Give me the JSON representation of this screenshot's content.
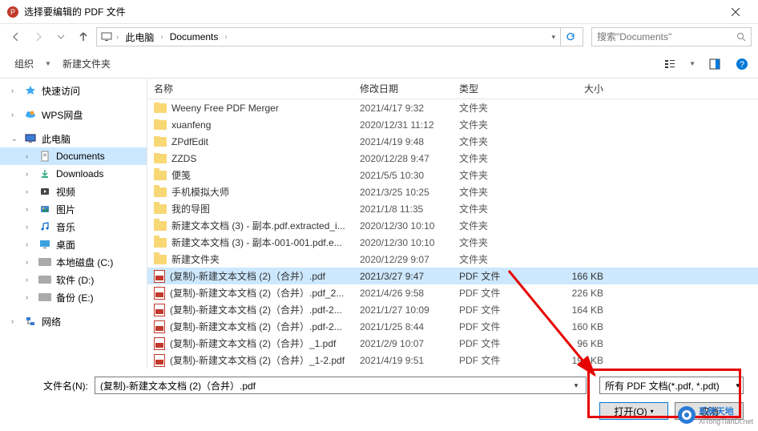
{
  "title": "选择要编辑的 PDF 文件",
  "breadcrumb": {
    "pc": "此电脑",
    "folder": "Documents"
  },
  "search_placeholder": "搜索\"Documents\"",
  "toolbar": {
    "organize": "组织",
    "new_folder": "新建文件夹"
  },
  "columns": {
    "name": "名称",
    "date": "修改日期",
    "type": "类型",
    "size": "大小"
  },
  "sidebar": {
    "quick_access": "快速访问",
    "wps": "WPS网盘",
    "this_pc": "此电脑",
    "documents": "Documents",
    "downloads": "Downloads",
    "videos": "视频",
    "pictures": "图片",
    "music": "音乐",
    "desktop": "桌面",
    "local_c": "本地磁盘 (C:)",
    "soft_d": "软件 (D:)",
    "backup_e": "备份 (E:)",
    "network": "网络"
  },
  "files": [
    {
      "name": "Weeny Free PDF Merger",
      "date": "2021/4/17 9:32",
      "type": "文件夹",
      "size": "",
      "icon": "folder"
    },
    {
      "name": "xuanfeng",
      "date": "2020/12/31 11:12",
      "type": "文件夹",
      "size": "",
      "icon": "folder"
    },
    {
      "name": "ZPdfEdit",
      "date": "2021/4/19 9:48",
      "type": "文件夹",
      "size": "",
      "icon": "folder"
    },
    {
      "name": "ZZDS",
      "date": "2020/12/28 9:47",
      "type": "文件夹",
      "size": "",
      "icon": "folder"
    },
    {
      "name": "便笺",
      "date": "2021/5/5 10:30",
      "type": "文件夹",
      "size": "",
      "icon": "folder"
    },
    {
      "name": "手机模拟大师",
      "date": "2021/3/25 10:25",
      "type": "文件夹",
      "size": "",
      "icon": "folder"
    },
    {
      "name": "我的导图",
      "date": "2021/1/8 11:35",
      "type": "文件夹",
      "size": "",
      "icon": "folder"
    },
    {
      "name": "新建文本文档 (3) - 副本.pdf.extracted_i...",
      "date": "2020/12/30 10:10",
      "type": "文件夹",
      "size": "",
      "icon": "folder"
    },
    {
      "name": "新建文本文档 (3) - 副本-001-001.pdf.e...",
      "date": "2020/12/30 10:10",
      "type": "文件夹",
      "size": "",
      "icon": "folder"
    },
    {
      "name": "新建文件夹",
      "date": "2020/12/29 9:07",
      "type": "文件夹",
      "size": "",
      "icon": "folder"
    },
    {
      "name": "(复制)-新建文本文档 (2)（合并）.pdf",
      "date": "2021/3/27 9:47",
      "type": "PDF 文件",
      "size": "166 KB",
      "icon": "pdf",
      "selected": true
    },
    {
      "name": "(复制)-新建文本文档 (2)（合并）.pdf_2...",
      "date": "2021/4/26 9:58",
      "type": "PDF 文件",
      "size": "226 KB",
      "icon": "pdf"
    },
    {
      "name": "(复制)-新建文本文档 (2)（合并）.pdf-2...",
      "date": "2021/1/27 10:09",
      "type": "PDF 文件",
      "size": "164 KB",
      "icon": "pdf"
    },
    {
      "name": "(复制)-新建文本文档 (2)（合并）.pdf-2...",
      "date": "2021/1/25 8:44",
      "type": "PDF 文件",
      "size": "160 KB",
      "icon": "pdf"
    },
    {
      "name": "(复制)-新建文本文档 (2)（合并）_1.pdf",
      "date": "2021/2/9 10:07",
      "type": "PDF 文件",
      "size": "96 KB",
      "icon": "pdf"
    },
    {
      "name": "(复制)-新建文本文档 (2)（合并）_1-2.pdf",
      "date": "2021/4/19 9:51",
      "type": "PDF 文件",
      "size": "194 KB",
      "icon": "pdf"
    }
  ],
  "filename_label": "文件名(N):",
  "filename_value": "(复制)-新建文本文档 (2)（合并）.pdf",
  "filter_label": "所有 PDF 文档(*.pdf, *.pdt)",
  "open_btn": "打开(O)",
  "cancel_btn": "取消",
  "watermark": {
    "main": "系统天地",
    "sub": "XiTongTianDi.net"
  }
}
